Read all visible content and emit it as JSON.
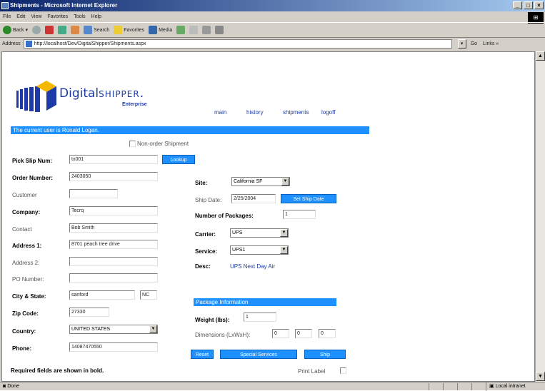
{
  "window": {
    "title": "Shipments - Microsoft Internet Explorer"
  },
  "menu": [
    "File",
    "Edit",
    "View",
    "Favorites",
    "Tools",
    "Help"
  ],
  "toolbar": {
    "back": "Back",
    "search": "Search",
    "favorites": "Favorites",
    "media": "Media"
  },
  "address": {
    "label": "Address",
    "url": "http://localhost/Dev/DigitalShipper/Shipments.aspx",
    "go": "Go",
    "links": "Links"
  },
  "logo": {
    "word_main": "Digital",
    "word_caps": "SHIPPER",
    "subtitle": "Enterprise"
  },
  "nav": [
    "main",
    "history",
    "shipments",
    "logoff"
  ],
  "current_user": "The current user is Ronald Logan.",
  "non_order": {
    "label": "Non-order Shipment",
    "checked": false
  },
  "left_form": {
    "pick_slip_label": "Pick Slip Num:",
    "pick_slip_value": "tx001",
    "lookup_btn": "Lookup",
    "order_number_label": "Order Number:",
    "order_number_value": "2403050",
    "customer_label": "Customer",
    "customer_value": "",
    "company_label": "Company:",
    "company_value": "Tecrq",
    "contact_label": "Contact",
    "contact_value": "Bob Smith",
    "address1_label": "Address 1:",
    "address1_value": "8701 peach tree drive",
    "address2_label": "Address 2:",
    "address2_value": "",
    "po_label": "PO Number:",
    "po_value": "",
    "city_state_label": "City & State:",
    "city_value": "sanford",
    "state_value": "NC",
    "zip_label": "Zip Code:",
    "zip_value": "27330",
    "country_label": "Country:",
    "country_value": "UNITED STATES",
    "phone_label": "Phone:",
    "phone_value": "14087470550"
  },
  "right_form": {
    "site_label": "Site:",
    "site_value": "California SF",
    "ship_date_label": "Ship Date:",
    "ship_date_value": "2/25/2004",
    "set_ship_date_btn": "Set Ship Date",
    "packages_label": "Number of Packages:",
    "packages_value": "1",
    "carrier_label": "Carrier:",
    "carrier_value": "UPS",
    "service_label": "Service:",
    "service_value": "UPS1",
    "desc_label": "Desc:",
    "desc_value": "UPS Next Day Air"
  },
  "package": {
    "header": "Package Information",
    "weight_label": "Weight (lbs):",
    "weight_value": "1",
    "dimensions_label": "Dimensions (LxWxH):",
    "length": "0",
    "width": "0",
    "height": "0"
  },
  "buttons": {
    "reset": "Reset",
    "special": "Special Services",
    "ship": "Ship"
  },
  "footer": {
    "required_note": "Required fields are shown in bold.",
    "print_label": "Print Label",
    "print_checked": false
  },
  "status": {
    "done": "Done",
    "zone": "Local intranet"
  }
}
